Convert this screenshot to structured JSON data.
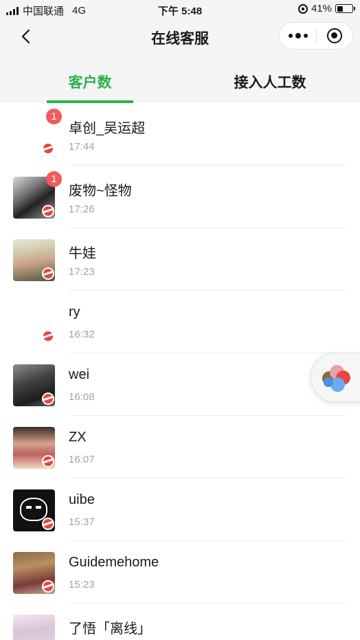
{
  "status_bar": {
    "carrier": "中国联通",
    "network": "4G",
    "time": "下午 5:48",
    "battery": "41%",
    "battery_level": 0.41
  },
  "nav": {
    "title": "在线客服",
    "back_icon": "chevron-left-icon",
    "more_icon": "more-dots-icon",
    "close_icon": "target-circle-icon"
  },
  "tabs": [
    {
      "label": "客户数",
      "active": true
    },
    {
      "label": "接入人工数",
      "active": false
    }
  ],
  "colors": {
    "accent": "#2bb14b",
    "badge": "#f15b5b",
    "channel": "#e84545"
  },
  "customers": [
    {
      "name": "卓创_吴运超",
      "time": "17:44",
      "unread": "1"
    },
    {
      "name": "废物~怪物",
      "time": "17:26",
      "unread": "1"
    },
    {
      "name": "牛娃",
      "time": "17:23",
      "unread": ""
    },
    {
      "name": "ry",
      "time": "16:32",
      "unread": ""
    },
    {
      "name": "wei",
      "time": "16:08",
      "unread": ""
    },
    {
      "name": "ZX",
      "time": "16:07",
      "unread": ""
    },
    {
      "name": "uibe",
      "time": "15:37",
      "unread": ""
    },
    {
      "name": "Guidemehome",
      "time": "15:23",
      "unread": ""
    },
    {
      "name": "了悟「离线」",
      "time": "",
      "unread": ""
    }
  ],
  "floating_button": {
    "icon": "photos-pinwheel-icon"
  }
}
